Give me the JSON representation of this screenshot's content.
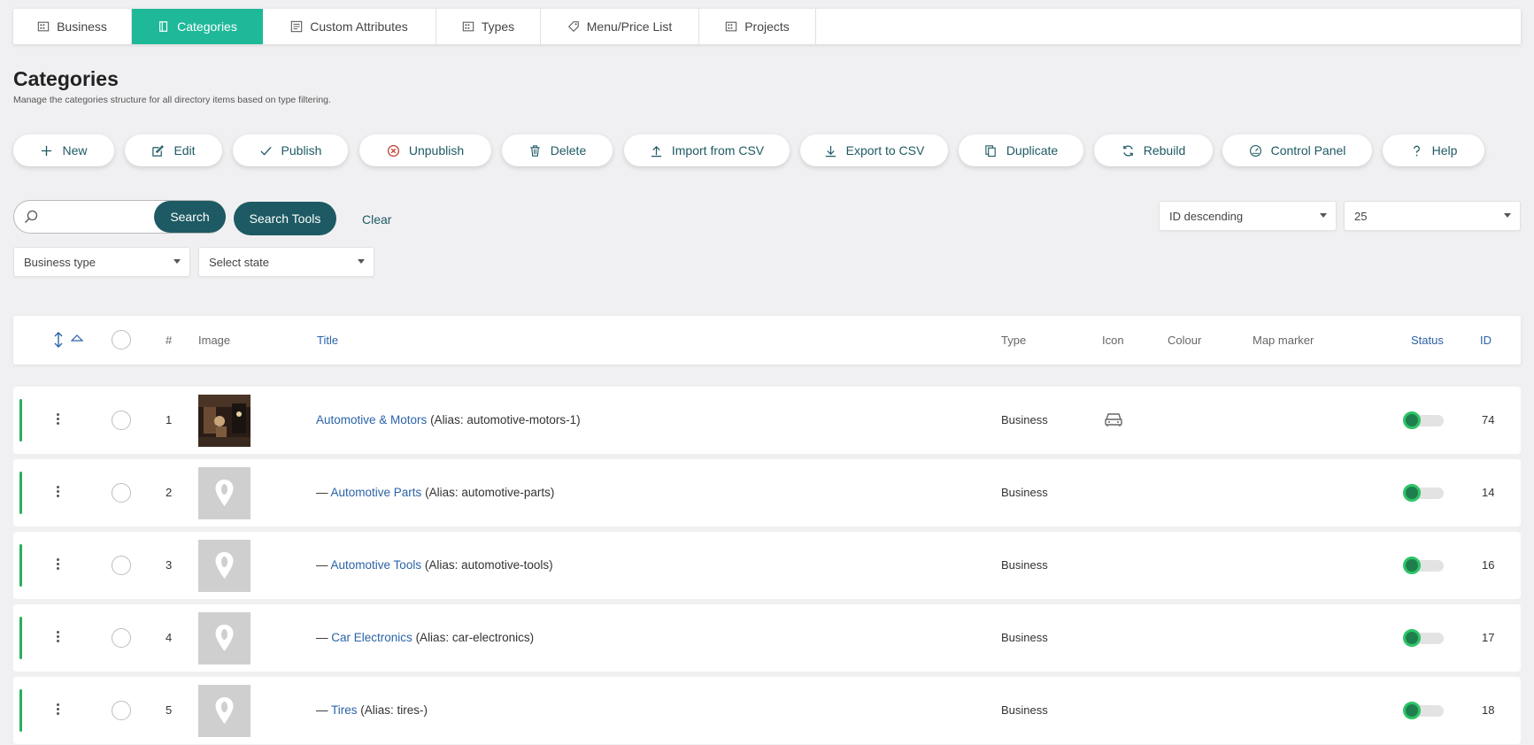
{
  "tabs": [
    {
      "label": "Business",
      "icon": "building-icon",
      "active": false
    },
    {
      "label": "Categories",
      "icon": "book-icon",
      "active": true
    },
    {
      "label": "Custom Attributes",
      "icon": "list-icon",
      "active": false
    },
    {
      "label": "Types",
      "icon": "building-icon",
      "active": false
    },
    {
      "label": "Menu/Price List",
      "icon": "tag-icon",
      "active": false
    },
    {
      "label": "Projects",
      "icon": "building-icon",
      "active": false
    }
  ],
  "page": {
    "title": "Categories",
    "subtitle": "Manage the categories structure for all directory items based on type filtering."
  },
  "toolbar": [
    {
      "label": "New",
      "icon": "plus-icon"
    },
    {
      "label": "Edit",
      "icon": "edit-icon"
    },
    {
      "label": "Publish",
      "icon": "check-icon"
    },
    {
      "label": "Unpublish",
      "icon": "circle-x-icon"
    },
    {
      "label": "Delete",
      "icon": "trash-icon"
    },
    {
      "label": "Import from CSV",
      "icon": "upload-icon"
    },
    {
      "label": "Export to CSV",
      "icon": "download-icon"
    },
    {
      "label": "Duplicate",
      "icon": "copy-icon"
    },
    {
      "label": "Rebuild",
      "icon": "refresh-icon"
    },
    {
      "label": "Control Panel",
      "icon": "gauge-icon"
    },
    {
      "label": "Help",
      "icon": "question-icon"
    }
  ],
  "search": {
    "value": "",
    "button": "Search",
    "tools_button": "Search Tools",
    "clear": "Clear"
  },
  "filters": {
    "business_type": "Business type",
    "state": "Select state",
    "ordering": "ID descending",
    "limit": "25"
  },
  "table": {
    "headers": {
      "num": "#",
      "image": "Image",
      "title": "Title",
      "type": "Type",
      "icon": "Icon",
      "colour": "Colour",
      "map_marker": "Map marker",
      "status": "Status",
      "id": "ID"
    },
    "rows": [
      {
        "num": "1",
        "prefix": "",
        "name": "Automotive & Motors",
        "alias": "(Alias: automotive-motors-1)",
        "type": "Business",
        "has_icon": true,
        "id": "74",
        "photo": true
      },
      {
        "num": "2",
        "prefix": "— ",
        "name": "Automotive Parts",
        "alias": "(Alias: automotive-parts)",
        "type": "Business",
        "has_icon": false,
        "id": "14",
        "photo": false
      },
      {
        "num": "3",
        "prefix": "— ",
        "name": "Automotive Tools",
        "alias": "(Alias: automotive-tools)",
        "type": "Business",
        "has_icon": false,
        "id": "16",
        "photo": false
      },
      {
        "num": "4",
        "prefix": "— ",
        "name": "Car Electronics",
        "alias": "(Alias: car-electronics)",
        "type": "Business",
        "has_icon": false,
        "id": "17",
        "photo": false
      },
      {
        "num": "5",
        "prefix": "— ",
        "name": "Tires",
        "alias": "(Alias: tires-)",
        "type": "Business",
        "has_icon": false,
        "id": "18",
        "photo": false
      }
    ]
  },
  "colors": {
    "accent": "#1fb99a",
    "primary": "#1d5a63",
    "link": "#2a63a8",
    "status_on": "#2ec467"
  }
}
